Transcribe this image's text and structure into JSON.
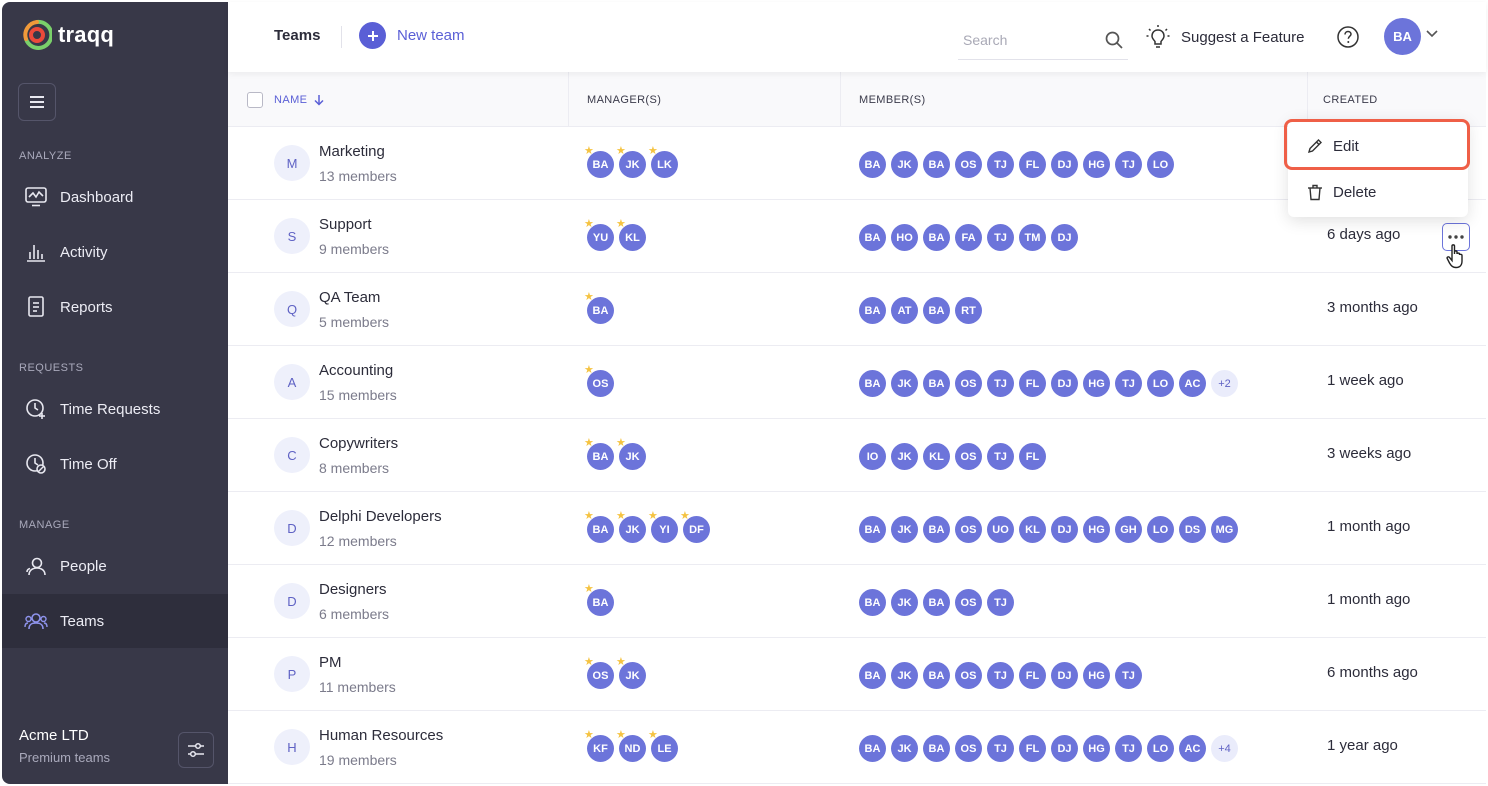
{
  "sidebar": {
    "logo": "traqq",
    "sections": {
      "analyze": "ANALYZE",
      "requests": "REQUESTS",
      "manage": "MANAGE"
    },
    "items": {
      "dashboard": "Dashboard",
      "activity": "Activity",
      "reports": "Reports",
      "time_requests": "Time Requests",
      "time_off": "Time Off",
      "people": "People",
      "teams": "Teams"
    },
    "org": {
      "name": "Acme LTD",
      "plan": "Premium teams"
    }
  },
  "header": {
    "title": "Teams",
    "new_team": "New team",
    "search_placeholder": "Search",
    "suggest": "Suggest a Feature",
    "avatar": "BA"
  },
  "table": {
    "columns": {
      "name": "NAME",
      "managers": "MANAGER(S)",
      "members": "MEMBER(S)",
      "created": "CREATED"
    },
    "rows": [
      {
        "initial": "M",
        "name": "Marketing",
        "members_count": "13 members",
        "managers": [
          "BA",
          "JK",
          "LK"
        ],
        "members": [
          "BA",
          "JK",
          "BA",
          "OS",
          "TJ",
          "FL",
          "DJ",
          "HG",
          "TJ",
          "LO"
        ],
        "more": "",
        "created": ""
      },
      {
        "initial": "S",
        "name": "Support",
        "members_count": "9 members",
        "managers": [
          "YU",
          "KL"
        ],
        "members": [
          "BA",
          "HO",
          "BA",
          "FA",
          "TJ",
          "TM",
          "DJ"
        ],
        "more": "",
        "created": "6 days ago"
      },
      {
        "initial": "Q",
        "name": "QA Team",
        "members_count": "5 members",
        "managers": [
          "BA"
        ],
        "members": [
          "BA",
          "AT",
          "BA",
          "RT"
        ],
        "more": "",
        "created": "3 months ago"
      },
      {
        "initial": "A",
        "name": "Accounting",
        "members_count": "15 members",
        "managers": [
          "OS"
        ],
        "members": [
          "BA",
          "JK",
          "BA",
          "OS",
          "TJ",
          "FL",
          "DJ",
          "HG",
          "TJ",
          "LO",
          "AC"
        ],
        "more": "+2",
        "created": "1 week ago"
      },
      {
        "initial": "C",
        "name": "Copywriters",
        "members_count": "8 members",
        "managers": [
          "BA",
          "JK"
        ],
        "members": [
          "IO",
          "JK",
          "KL",
          "OS",
          "TJ",
          "FL"
        ],
        "more": "",
        "created": "3 weeks ago"
      },
      {
        "initial": "D",
        "name": "Delphi Developers",
        "members_count": "12 members",
        "managers": [
          "BA",
          "JK",
          "YI",
          "DF"
        ],
        "members": [
          "BA",
          "JK",
          "BA",
          "OS",
          "UO",
          "KL",
          "DJ",
          "HG",
          "GH",
          "LO",
          "DS",
          "MG"
        ],
        "more": "",
        "created": "1 month ago"
      },
      {
        "initial": "D",
        "name": "Designers",
        "members_count": "6 members",
        "managers": [
          "BA"
        ],
        "members": [
          "BA",
          "JK",
          "BA",
          "OS",
          "TJ"
        ],
        "more": "",
        "created": "1 month ago"
      },
      {
        "initial": "P",
        "name": "PM",
        "members_count": "11 members",
        "managers": [
          "OS",
          "JK"
        ],
        "members": [
          "BA",
          "JK",
          "BA",
          "OS",
          "TJ",
          "FL",
          "DJ",
          "HG",
          "TJ"
        ],
        "more": "",
        "created": "6 months ago"
      },
      {
        "initial": "H",
        "name": "Human Resources",
        "members_count": "19 members",
        "managers": [
          "KF",
          "ND",
          "LE"
        ],
        "members": [
          "BA",
          "JK",
          "BA",
          "OS",
          "TJ",
          "FL",
          "DJ",
          "HG",
          "TJ",
          "LO",
          "AC"
        ],
        "more": "+4",
        "created": "1 year ago"
      }
    ]
  },
  "dropdown": {
    "edit": "Edit",
    "delete": "Delete"
  },
  "colors": {
    "accent": "#5a5fd6",
    "avatar": "#6c74da",
    "sidebar": "#383848",
    "highlight": "#ef5f47",
    "star": "#f5c342"
  }
}
